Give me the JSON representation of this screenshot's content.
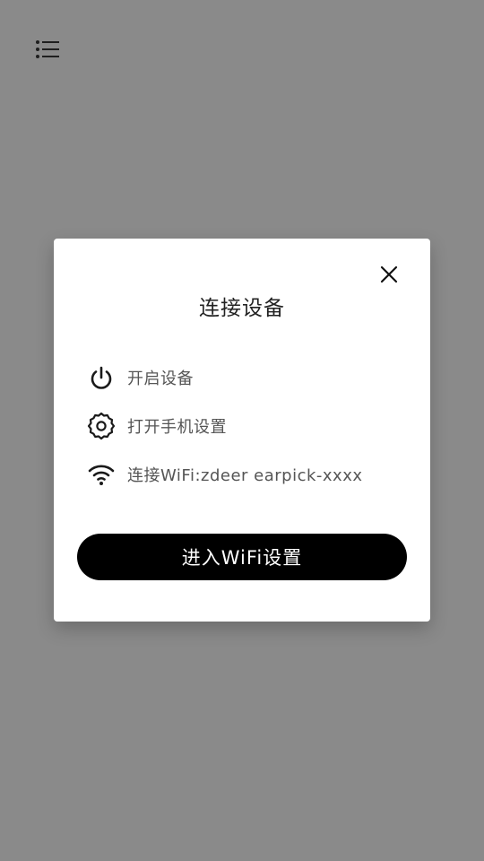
{
  "header": {
    "menu_icon": "hamburger-menu-icon"
  },
  "modal": {
    "title": "连接设备",
    "close_icon": "close-icon",
    "steps": [
      {
        "icon": "power-icon",
        "label": "开启设备"
      },
      {
        "icon": "settings-gear-icon",
        "label": "打开手机设置"
      },
      {
        "icon": "wifi-icon",
        "label": "连接WiFi:zdeer earpick-xxxx"
      }
    ],
    "primary_button_label": "进入WiFi设置"
  },
  "colors": {
    "overlay_background": "#8a8a8a",
    "modal_background": "#ffffff",
    "primary_button": "#000000",
    "primary_text": "#222222",
    "secondary_text": "#555555"
  }
}
